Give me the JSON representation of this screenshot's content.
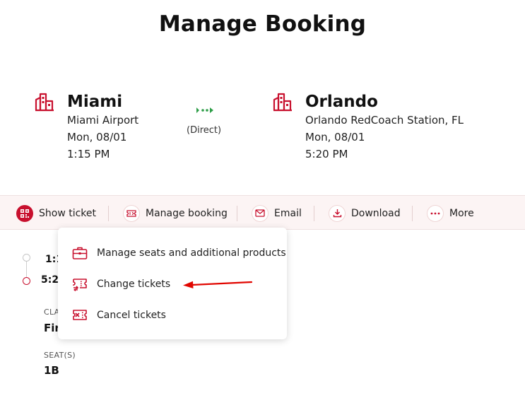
{
  "page": {
    "title": "Manage Booking"
  },
  "departure": {
    "city": "Miami",
    "station": "Miami Airport",
    "date": "Mon, 08/01",
    "time": "1:15 PM"
  },
  "arrival": {
    "city": "Orlando",
    "station": "Orlando RedCoach Station, FL",
    "date": "Mon, 08/01",
    "time": "5:20 PM"
  },
  "route": {
    "type_label": "(Direct)"
  },
  "toolbar": {
    "show_ticket": "Show ticket",
    "manage_booking": "Manage booking",
    "email": "Email",
    "download": "Download",
    "more": "More"
  },
  "timeline": {
    "depart_time_partial": "1:1",
    "arrive_time_partial": "5:2"
  },
  "details": {
    "class_label_partial": "CLA",
    "class_value_partial": "Fir",
    "seats_label": "SEAT(S)",
    "seats_value": "1B"
  },
  "dropdown": {
    "items": [
      {
        "label": "Manage seats and additional products",
        "icon": "briefcase-icon"
      },
      {
        "label": "Change tickets",
        "icon": "ticket-swap-icon"
      },
      {
        "label": "Cancel tickets",
        "icon": "ticket-cancel-icon"
      }
    ]
  },
  "colors": {
    "brand_red": "#c8102e",
    "direct_green": "#2e9e48",
    "toolbar_bg": "#fcf4f4"
  }
}
